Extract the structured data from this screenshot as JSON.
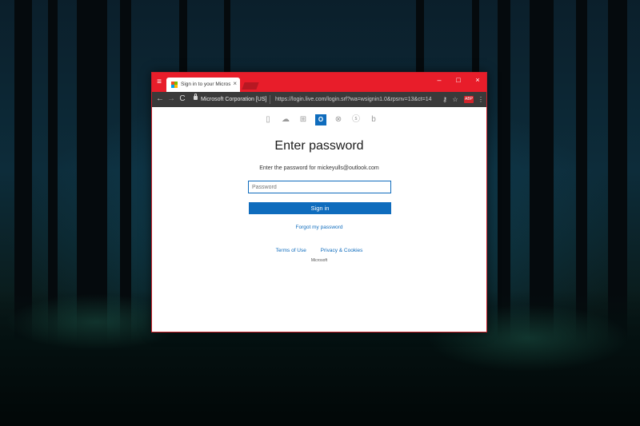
{
  "browser": {
    "tab": {
      "title": "Sign in to your Microsoft",
      "close_glyph": "×"
    },
    "window_controls": {
      "minimize": "–",
      "maximize": "□",
      "close": "×"
    },
    "toolbar": {
      "back_glyph": "←",
      "forward_glyph": "→",
      "reload_glyph": "C",
      "ev_name": "Microsoft Corporation [US]",
      "url": "https://login.live.com/login.srf?wa=wsignin1.0&rpsnv=13&ct=14",
      "extension_label": "ABP",
      "menu_glyph": "⋮"
    }
  },
  "login": {
    "services": [
      "office-icon",
      "onedrive-icon",
      "windows-icon",
      "outlook-icon",
      "xbox-icon",
      "skype-icon",
      "bing-icon"
    ],
    "active_service_glyph": "O",
    "heading": "Enter password",
    "instruction": "Enter the password for mickeyulls@outlook.com",
    "password_placeholder": "Password",
    "signin_label": "Sign in",
    "forgot_label": "Forgot my password",
    "terms_label": "Terms of Use",
    "privacy_label": "Privacy & Cookies",
    "brand_label": "Microsoft"
  },
  "colors": {
    "accent": "#0f6cbd",
    "browser_frame": "#e81d2a",
    "toolbar": "#3a3a3a"
  }
}
